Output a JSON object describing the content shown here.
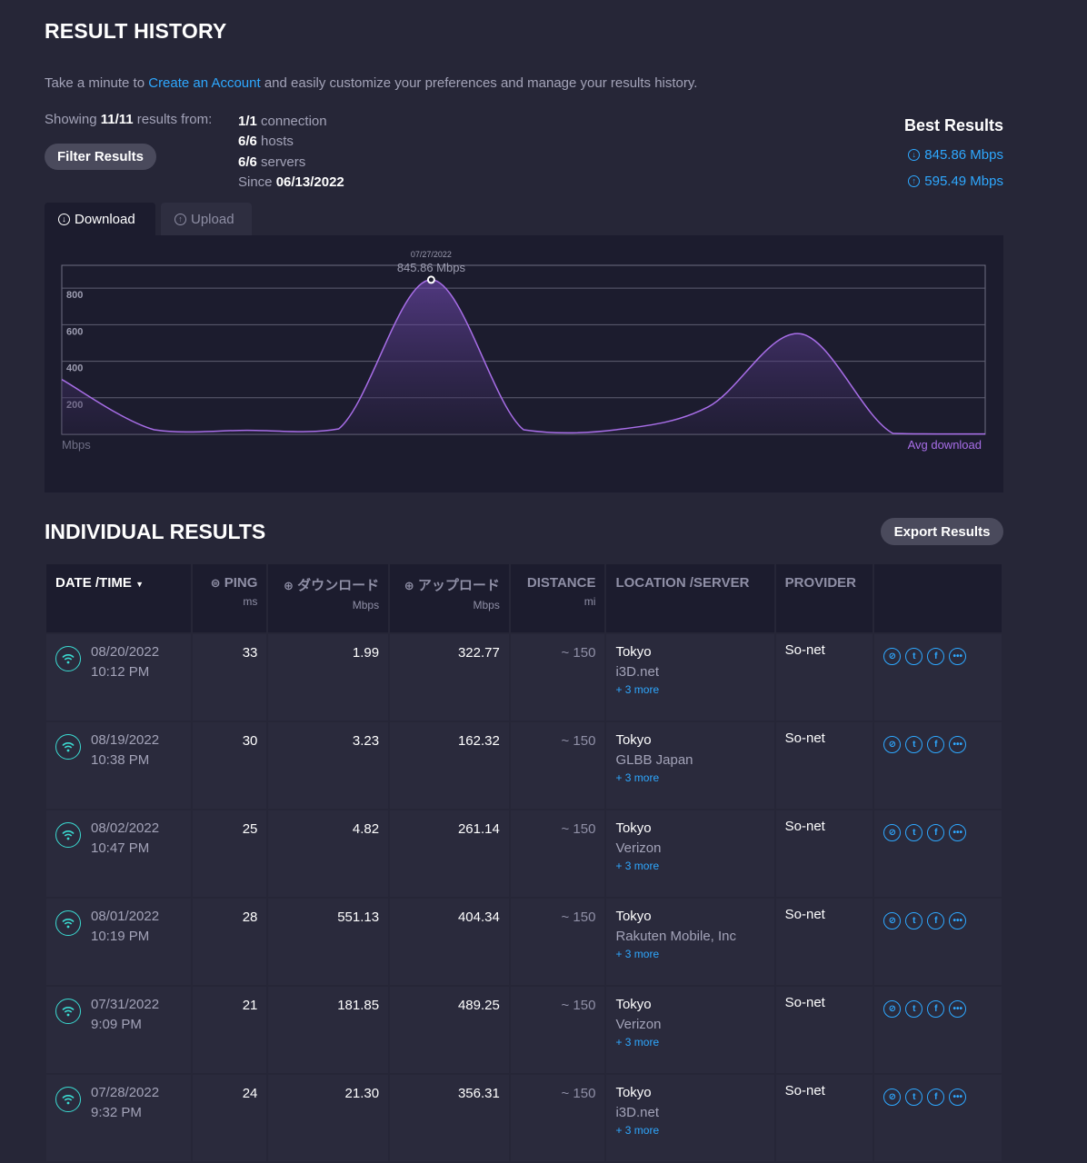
{
  "header": {
    "title": "RESULT HISTORY"
  },
  "intro": {
    "before": "Take a minute to ",
    "link": "Create an Account",
    "after": " and easily customize your preferences and manage your results history."
  },
  "summary": {
    "showing_prefix": "Showing ",
    "showing_count": "11/11",
    "showing_suffix": " results from:",
    "connection_count": "1/1",
    "connection_label": " connection",
    "hosts_count": "6/6",
    "hosts_label": " hosts",
    "servers_count": "6/6",
    "servers_label": " servers",
    "since_label": "Since ",
    "since_date": "06/13/2022"
  },
  "filter_button": "Filter Results",
  "best": {
    "title": "Best Results",
    "download": "845.86 Mbps",
    "upload": "595.49 Mbps"
  },
  "tabs": [
    {
      "label": "Download"
    },
    {
      "label": "Upload"
    }
  ],
  "chart_data": {
    "type": "area",
    "y_ticks": [
      "800",
      "600",
      "400",
      "200"
    ],
    "ylim": [
      0,
      925
    ],
    "ylabel": "Mbps",
    "legend": "Avg download",
    "peak": {
      "date": "07/27/2022",
      "label": "845.86 Mbps",
      "value": 845.86
    },
    "line_color": "#a86ee8",
    "series": [
      {
        "values": [
          300,
          25,
          22,
          30,
          845.86,
          25,
          25,
          150,
          550,
          5,
          2
        ]
      }
    ]
  },
  "individual": {
    "title": "INDIVIDUAL RESULTS",
    "export": "Export Results",
    "columns": {
      "date": "DATE /TIME",
      "ping": "PING",
      "ping_unit": "ms",
      "download": "ダウンロード",
      "download_unit": "Mbps",
      "upload": "アップロード",
      "upload_unit": "Mbps",
      "distance": "DISTANCE",
      "distance_unit": "mi",
      "location": "LOCATION /SERVER",
      "provider": "PROVIDER"
    },
    "rows": [
      {
        "date": "08/20/2022",
        "time": "10:12 PM",
        "ping": "33",
        "download": "1.99",
        "upload": "322.77",
        "distance": "~ 150",
        "city": "Tokyo",
        "server": "i3D.net",
        "more": "+ 3 more",
        "provider": "So-net"
      },
      {
        "date": "08/19/2022",
        "time": "10:38 PM",
        "ping": "30",
        "download": "3.23",
        "upload": "162.32",
        "distance": "~ 150",
        "city": "Tokyo",
        "server": "GLBB Japan",
        "more": "+ 3 more",
        "provider": "So-net"
      },
      {
        "date": "08/02/2022",
        "time": "10:47 PM",
        "ping": "25",
        "download": "4.82",
        "upload": "261.14",
        "distance": "~ 150",
        "city": "Tokyo",
        "server": "Verizon",
        "more": "+ 3 more",
        "provider": "So-net"
      },
      {
        "date": "08/01/2022",
        "time": "10:19 PM",
        "ping": "28",
        "download": "551.13",
        "upload": "404.34",
        "distance": "~ 150",
        "city": "Tokyo",
        "server": "Rakuten Mobile, Inc",
        "more": "+ 3 more",
        "provider": "So-net"
      },
      {
        "date": "07/31/2022",
        "time": "9:09 PM",
        "ping": "21",
        "download": "181.85",
        "upload": "489.25",
        "distance": "~ 150",
        "city": "Tokyo",
        "server": "Verizon",
        "more": "+ 3 more",
        "provider": "So-net"
      },
      {
        "date": "07/28/2022",
        "time": "9:32 PM",
        "ping": "24",
        "download": "21.30",
        "upload": "356.31",
        "distance": "~ 150",
        "city": "Tokyo",
        "server": "i3D.net",
        "more": "+ 3 more",
        "provider": "So-net"
      }
    ]
  },
  "icons": {
    "download": "arrow-down-circle-icon",
    "upload": "arrow-up-circle-icon",
    "row": "wifi-icon",
    "share": [
      "link-icon",
      "twitter-icon",
      "facebook-icon",
      "more-icon"
    ]
  }
}
